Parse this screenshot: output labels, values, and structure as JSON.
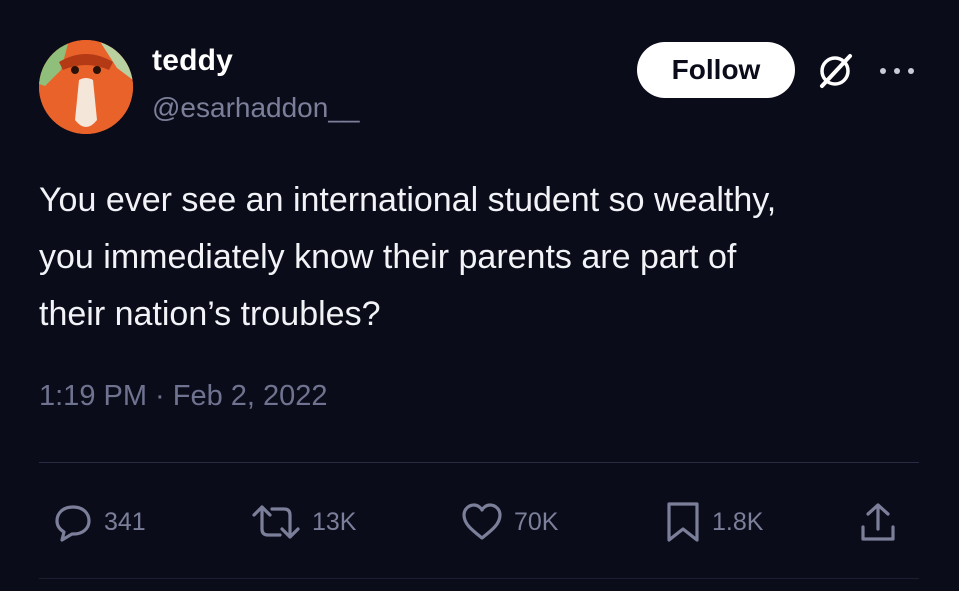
{
  "author": {
    "name": "teddy",
    "handle": "@esarhaddon__"
  },
  "header": {
    "follow_label": "Follow"
  },
  "tweet": {
    "text": "You ever see an international student so wealthy,\nyou immediately know their parents are part of\ntheir nation’s troubles?",
    "timestamp": "1:19 PM · Feb 2, 2022"
  },
  "actions": {
    "replies": "341",
    "retweets": "13K",
    "likes": "70K",
    "bookmarks": "1.8K"
  },
  "icons": [
    "avatar",
    "grok-icon",
    "more-icon",
    "reply-icon",
    "retweet-icon",
    "like-icon",
    "bookmark-icon",
    "share-icon"
  ],
  "colors": {
    "background": "#0b0c1a",
    "text": "#f2f3f7",
    "muted": "#7b7f99",
    "avatar": "#e8622a"
  }
}
